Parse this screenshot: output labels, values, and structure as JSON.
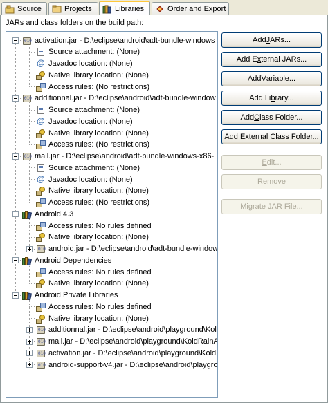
{
  "tabs": [
    {
      "label": "Source",
      "icon": "source-tab-icon"
    },
    {
      "label": "Projects",
      "icon": "projects-tab-icon"
    },
    {
      "label": "Libraries",
      "icon": "libraries-tab-icon",
      "active": true
    },
    {
      "label": "Order and Export",
      "icon": "order-export-tab-icon"
    }
  ],
  "panel_label": "JARs and class folders on the build path:",
  "tree": [
    {
      "text": "activation.jar - D:\\eclipse\\android\\adt-bundle-windows",
      "icon": "jar",
      "level": 0,
      "expander": "minus"
    },
    {
      "text": "Source attachment: (None)",
      "icon": "source",
      "level": 1
    },
    {
      "text": "Javadoc location: (None)",
      "icon": "javadoc",
      "level": 1
    },
    {
      "text": "Native library location: (None)",
      "icon": "native",
      "level": 1
    },
    {
      "text": "Access rules: (No restrictions)",
      "icon": "access",
      "level": 1
    },
    {
      "text": "additionnal.jar - D:\\eclipse\\android\\adt-bundle-window",
      "icon": "jar",
      "level": 0,
      "expander": "minus"
    },
    {
      "text": "Source attachment: (None)",
      "icon": "source",
      "level": 1
    },
    {
      "text": "Javadoc location: (None)",
      "icon": "javadoc",
      "level": 1
    },
    {
      "text": "Native library location: (None)",
      "icon": "native",
      "level": 1
    },
    {
      "text": "Access rules: (No restrictions)",
      "icon": "access",
      "level": 1
    },
    {
      "text": "mail.jar - D:\\eclipse\\android\\adt-bundle-windows-x86-",
      "icon": "jar",
      "level": 0,
      "expander": "minus"
    },
    {
      "text": "Source attachment: (None)",
      "icon": "source",
      "level": 1
    },
    {
      "text": "Javadoc location: (None)",
      "icon": "javadoc",
      "level": 1
    },
    {
      "text": "Native library location: (None)",
      "icon": "native",
      "level": 1
    },
    {
      "text": "Access rules: (No restrictions)",
      "icon": "access",
      "level": 1
    },
    {
      "text": "Android 4.3",
      "icon": "library",
      "level": 0,
      "expander": "minus"
    },
    {
      "text": "Access rules: No rules defined",
      "icon": "access",
      "level": 1
    },
    {
      "text": "Native library location: (None)",
      "icon": "native",
      "level": 1
    },
    {
      "text": "android.jar - D:\\eclipse\\android\\adt-bundle-window",
      "icon": "jar",
      "level": 1,
      "expander": "plus"
    },
    {
      "text": "Android Dependencies",
      "icon": "library",
      "level": 0,
      "expander": "minus"
    },
    {
      "text": "Access rules: No rules defined",
      "icon": "access",
      "level": 1
    },
    {
      "text": "Native library location: (None)",
      "icon": "native",
      "level": 1
    },
    {
      "text": "Android Private Libraries",
      "icon": "library",
      "level": 0,
      "expander": "minus"
    },
    {
      "text": "Access rules: No rules defined",
      "icon": "access",
      "level": 1
    },
    {
      "text": "Native library location: (None)",
      "icon": "native",
      "level": 1
    },
    {
      "text": "additionnal.jar - D:\\eclipse\\android\\playground\\Kol",
      "icon": "jar",
      "level": 1,
      "expander": "plus"
    },
    {
      "text": "mail.jar - D:\\eclipse\\android\\playground\\KoldRainA",
      "icon": "jar",
      "level": 1,
      "expander": "plus"
    },
    {
      "text": "activation.jar - D:\\eclipse\\android\\playground\\Kold",
      "icon": "jar",
      "level": 1,
      "expander": "plus"
    },
    {
      "text": "android-support-v4.jar - D:\\eclipse\\android\\playgro",
      "icon": "jar",
      "level": 1,
      "expander": "plus"
    }
  ],
  "buttons": [
    {
      "name": "add-jars-button",
      "pre": "Add ",
      "mn": "J",
      "post": "ARs...",
      "enabled": true
    },
    {
      "name": "add-external-jars-button",
      "pre": "Add E",
      "mn": "x",
      "post": "ternal JARs...",
      "enabled": true
    },
    {
      "name": "add-variable-button",
      "pre": "Add ",
      "mn": "V",
      "post": "ariable...",
      "enabled": true
    },
    {
      "name": "add-library-button",
      "pre": "Add Li",
      "mn": "b",
      "post": "rary...",
      "enabled": true
    },
    {
      "name": "add-class-folder-button",
      "pre": "Add ",
      "mn": "C",
      "post": "lass Folder...",
      "enabled": true
    },
    {
      "name": "add-external-class-folder-button",
      "pre": "Add External Class Fold",
      "mn": "e",
      "post": "r...",
      "enabled": true
    },
    {
      "name": "edit-button",
      "pre": "",
      "mn": "E",
      "post": "dit...",
      "enabled": false
    },
    {
      "name": "remove-button",
      "pre": "",
      "mn": "R",
      "post": "emove",
      "enabled": false
    },
    {
      "name": "migrate-jar-file-button",
      "pre": "Migrate JAR File...",
      "mn": "",
      "post": "",
      "enabled": false
    }
  ]
}
